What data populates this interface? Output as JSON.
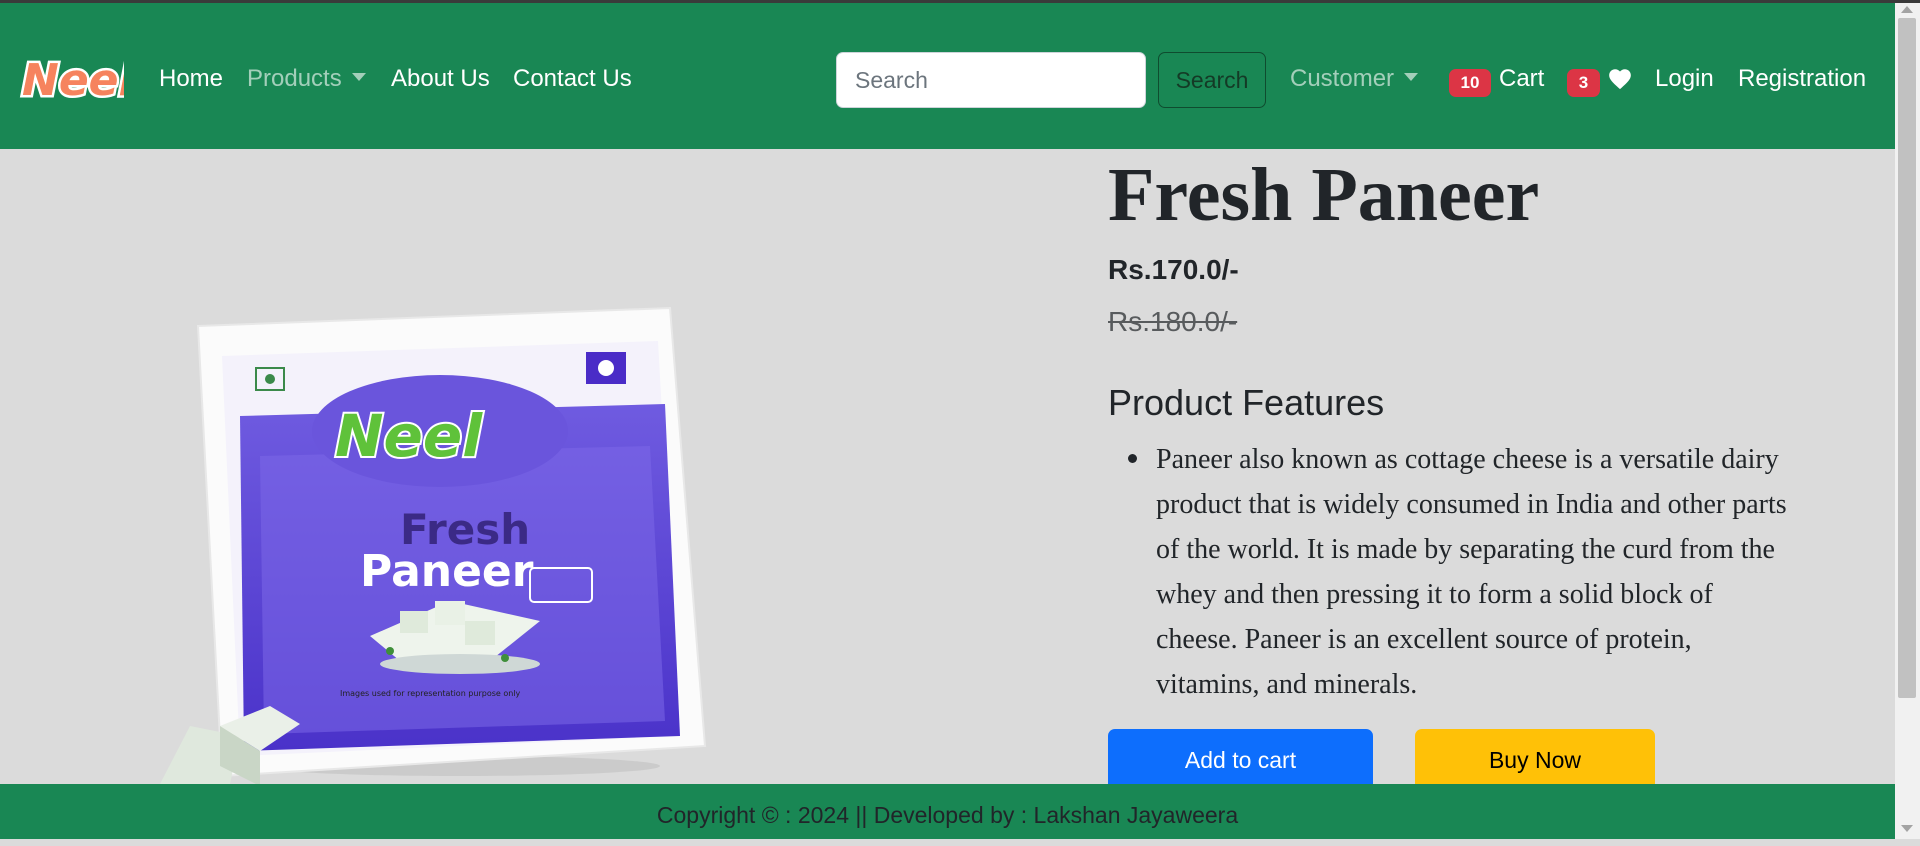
{
  "nav": {
    "brand": "Neel",
    "links": [
      {
        "label": "Home"
      },
      {
        "label": "Products"
      },
      {
        "label": "About Us"
      },
      {
        "label": "Contact Us"
      }
    ],
    "search": {
      "placeholder": "Search",
      "button_label": "Search"
    },
    "customer_label": "Customer",
    "cart": {
      "count": "10",
      "label": "Cart"
    },
    "wishlist": {
      "count": "3"
    },
    "login_label": "Login",
    "registration_label": "Registration"
  },
  "product": {
    "name": "Fresh Paneer",
    "price": "Rs.170.0/-",
    "old_price": "Rs.180.0/-",
    "features_heading": "Product Features",
    "features": [
      "Paneer also known as cottage cheese is a versatile dairy product that is widely consumed in India and other parts of the world. It is made by separating the curd from the whey and then pressing it to form a solid block of cheese. Paneer is an excellent source of protein, vitamins, and minerals."
    ],
    "add_to_cart_label": "Add to cart",
    "buy_now_label": "Buy Now",
    "package": {
      "brand": "Neel",
      "line1": "Fresh",
      "line2": "Paneer",
      "note": "Images used for representation purpose only"
    }
  },
  "footer": {
    "text": "Copyright © : 2024 || Developed by : Lakshan Jayaweera"
  },
  "colors": {
    "navbar": "#198754",
    "primary": "#0d6efd",
    "warning": "#ffc107",
    "badge": "#dc3545",
    "page_bg": "#dbdbdb"
  },
  "icons": {
    "wishlist": "heart-icon",
    "dropdown": "caret-down-icon"
  }
}
